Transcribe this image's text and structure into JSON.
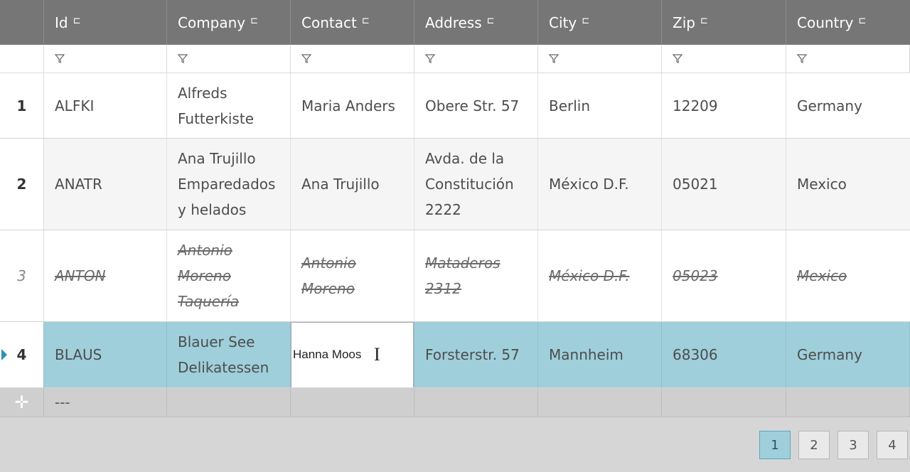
{
  "columns": [
    {
      "label": ""
    },
    {
      "label": "Id"
    },
    {
      "label": "Company"
    },
    {
      "label": "Contact"
    },
    {
      "label": "Address"
    },
    {
      "label": "City"
    },
    {
      "label": "Zip"
    },
    {
      "label": "Country"
    }
  ],
  "rows": [
    {
      "num": "1",
      "id": "ALFKI",
      "company": [
        "Alfreds",
        "Futterkiste"
      ],
      "contact": "Maria Anders",
      "address": [
        "Obere Str. 57"
      ],
      "city": "Berlin",
      "zip": "12209",
      "country": "Germany"
    },
    {
      "num": "2",
      "id": "ANATR",
      "company": [
        "Ana Trujillo",
        "Emparedados",
        "y helados"
      ],
      "contact": "Ana Trujillo",
      "address": [
        "Avda. de la",
        "Constitución",
        "2222"
      ],
      "city": "México D.F.",
      "zip": "05021",
      "country": "Mexico"
    },
    {
      "num": "3",
      "id": "ANTON",
      "company": [
        "Antonio",
        "Moreno",
        "Taquería"
      ],
      "contact": [
        "Antonio",
        "Moreno"
      ],
      "address": [
        "Mataderos",
        "2312"
      ],
      "city": "México D.F.",
      "zip": "05023",
      "country": "Mexico",
      "deleted": true
    },
    {
      "num": "4",
      "id": "BLAUS",
      "company": [
        "Blauer See",
        "Delikatessen"
      ],
      "contact_edit_value": "Hanna Moos",
      "address": [
        "Forsterstr. 57"
      ],
      "city": "Mannheim",
      "zip": "68306",
      "country": "Germany",
      "selected": true
    }
  ],
  "new_row": {
    "id_placeholder": "---"
  },
  "pager": {
    "pages": [
      "1",
      "2",
      "3",
      "4"
    ],
    "active": "1"
  },
  "colors": {
    "header": "#767676",
    "selected": "#9fcfdb",
    "pager_active": "#9fcfdb"
  }
}
